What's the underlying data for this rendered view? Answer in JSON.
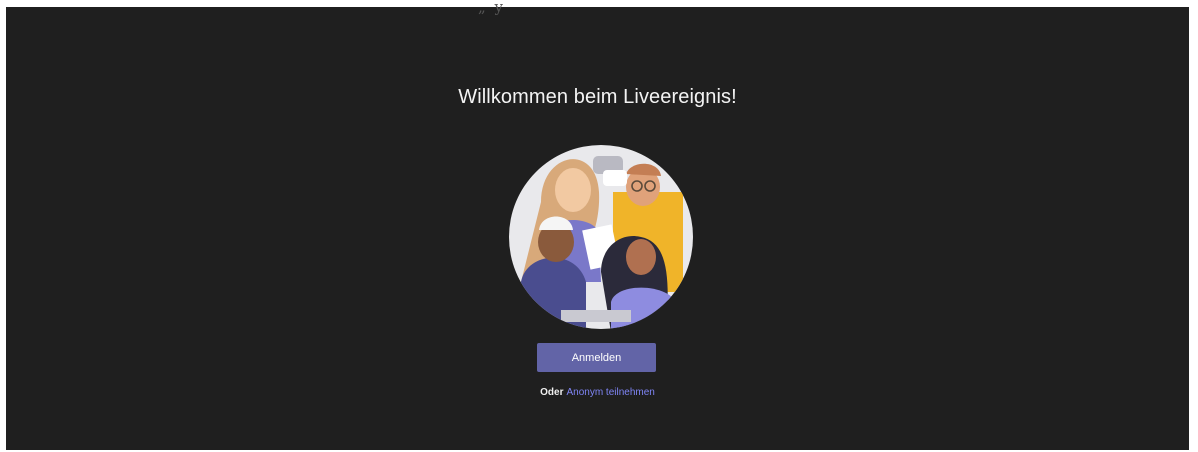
{
  "top_mark": "„ y",
  "title": "Willkommen beim Liveereignis!",
  "illustration": "people-group-illustration",
  "signin_button": "Anmelden",
  "alt_prefix": "Oder",
  "anonymous_link": "Anonym teilnehmen",
  "colors": {
    "background": "#1f1f1f",
    "accent": "#6264a7",
    "link": "#7f85f5",
    "text": "#f3f3f3"
  }
}
